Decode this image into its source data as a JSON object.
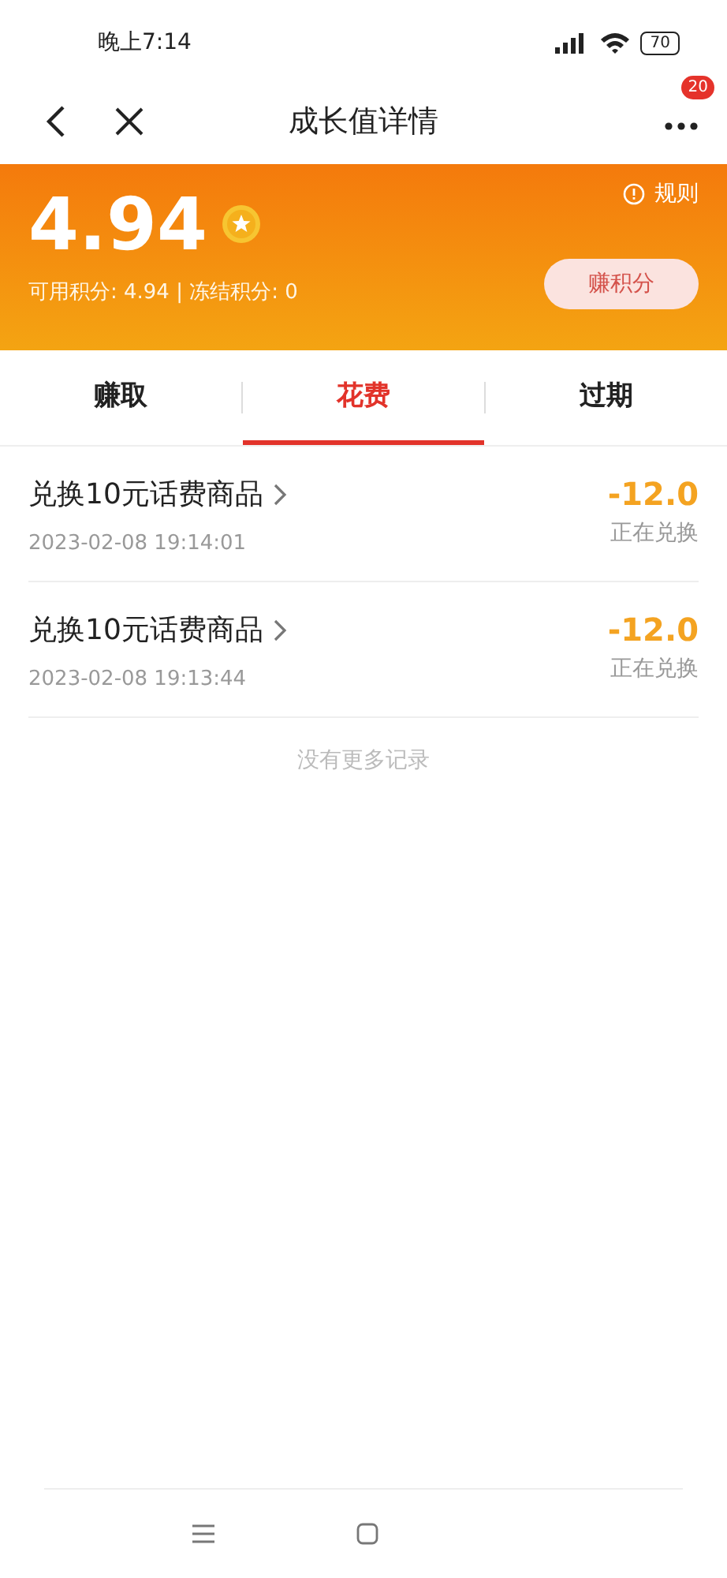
{
  "status_bar": {
    "time": "晚上7:14",
    "battery": "70"
  },
  "header": {
    "title": "成长值详情",
    "badge": "20"
  },
  "banner": {
    "points": "4.94",
    "rules": "规则",
    "summary": "可用积分: 4.94 | 冻结积分: 0",
    "earn_button": "赚积分"
  },
  "tabs": [
    {
      "label": "赚取",
      "selected": false
    },
    {
      "label": "花费",
      "selected": true
    },
    {
      "label": "过期",
      "selected": false
    }
  ],
  "records": [
    {
      "title": "兑换10元话费商品",
      "time": "2023-02-08 19:14:01",
      "amount": "-12.0",
      "status": "正在兑换"
    },
    {
      "title": "兑换10元话费商品",
      "time": "2023-02-08 19:13:44",
      "amount": "-12.0",
      "status": "正在兑换"
    }
  ],
  "footer_note": "没有更多记录"
}
